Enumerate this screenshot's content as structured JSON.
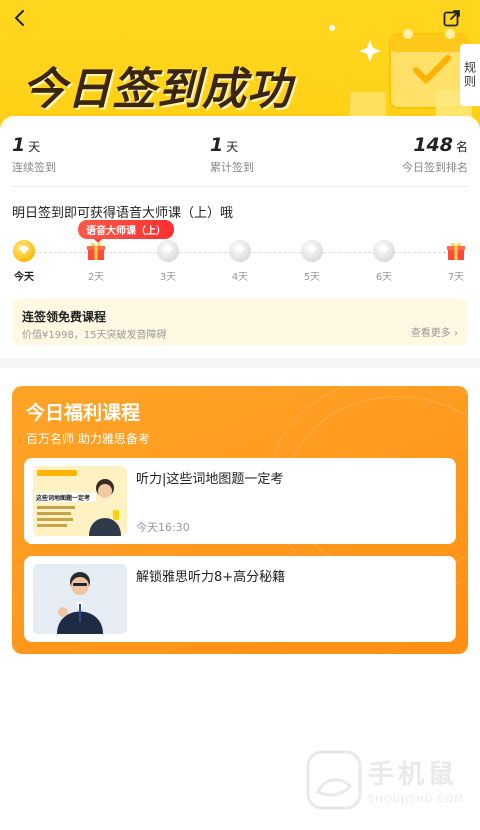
{
  "header": {
    "title": "今日签到成功",
    "rules_label": "规则"
  },
  "stats": [
    {
      "num": "1",
      "unit": "天",
      "label": "连续签到"
    },
    {
      "num": "1",
      "unit": "天",
      "label": "累计签到"
    },
    {
      "num": "148",
      "unit": "名",
      "label": "今日签到排名"
    }
  ],
  "tip": "明日签到即可获得语音大师课（上）哦",
  "reward_badge": "语音大师课（上）",
  "days": [
    {
      "label": "今天",
      "kind": "active"
    },
    {
      "label": "2天",
      "kind": "gift"
    },
    {
      "label": "3天",
      "kind": "gray"
    },
    {
      "label": "4天",
      "kind": "gray"
    },
    {
      "label": "5天",
      "kind": "gray"
    },
    {
      "label": "6天",
      "kind": "gray"
    },
    {
      "label": "7天",
      "kind": "gift"
    }
  ],
  "streak": {
    "title": "连签领免费课程",
    "desc": "价值¥1998，15天突破发音障碍",
    "more": "查看更多 ›"
  },
  "benefit": {
    "title": "今日福利课程",
    "subtitle": "百万名师 助力雅思备考",
    "courses": [
      {
        "title": "听力|这些词地图题一定考",
        "time": "今天16:30",
        "thumb_text": "这些词地图题一定考"
      },
      {
        "title": "解锁雅思听力8+高分秘籍",
        "time": ""
      }
    ]
  },
  "watermark": {
    "name": "手机鼠",
    "domain": "SHOUJISHU.COM"
  },
  "colors": {
    "header_yellow": "#ffd31a",
    "panel_orange": "#ff9a1f",
    "badge_red": "#ff3b3b"
  }
}
